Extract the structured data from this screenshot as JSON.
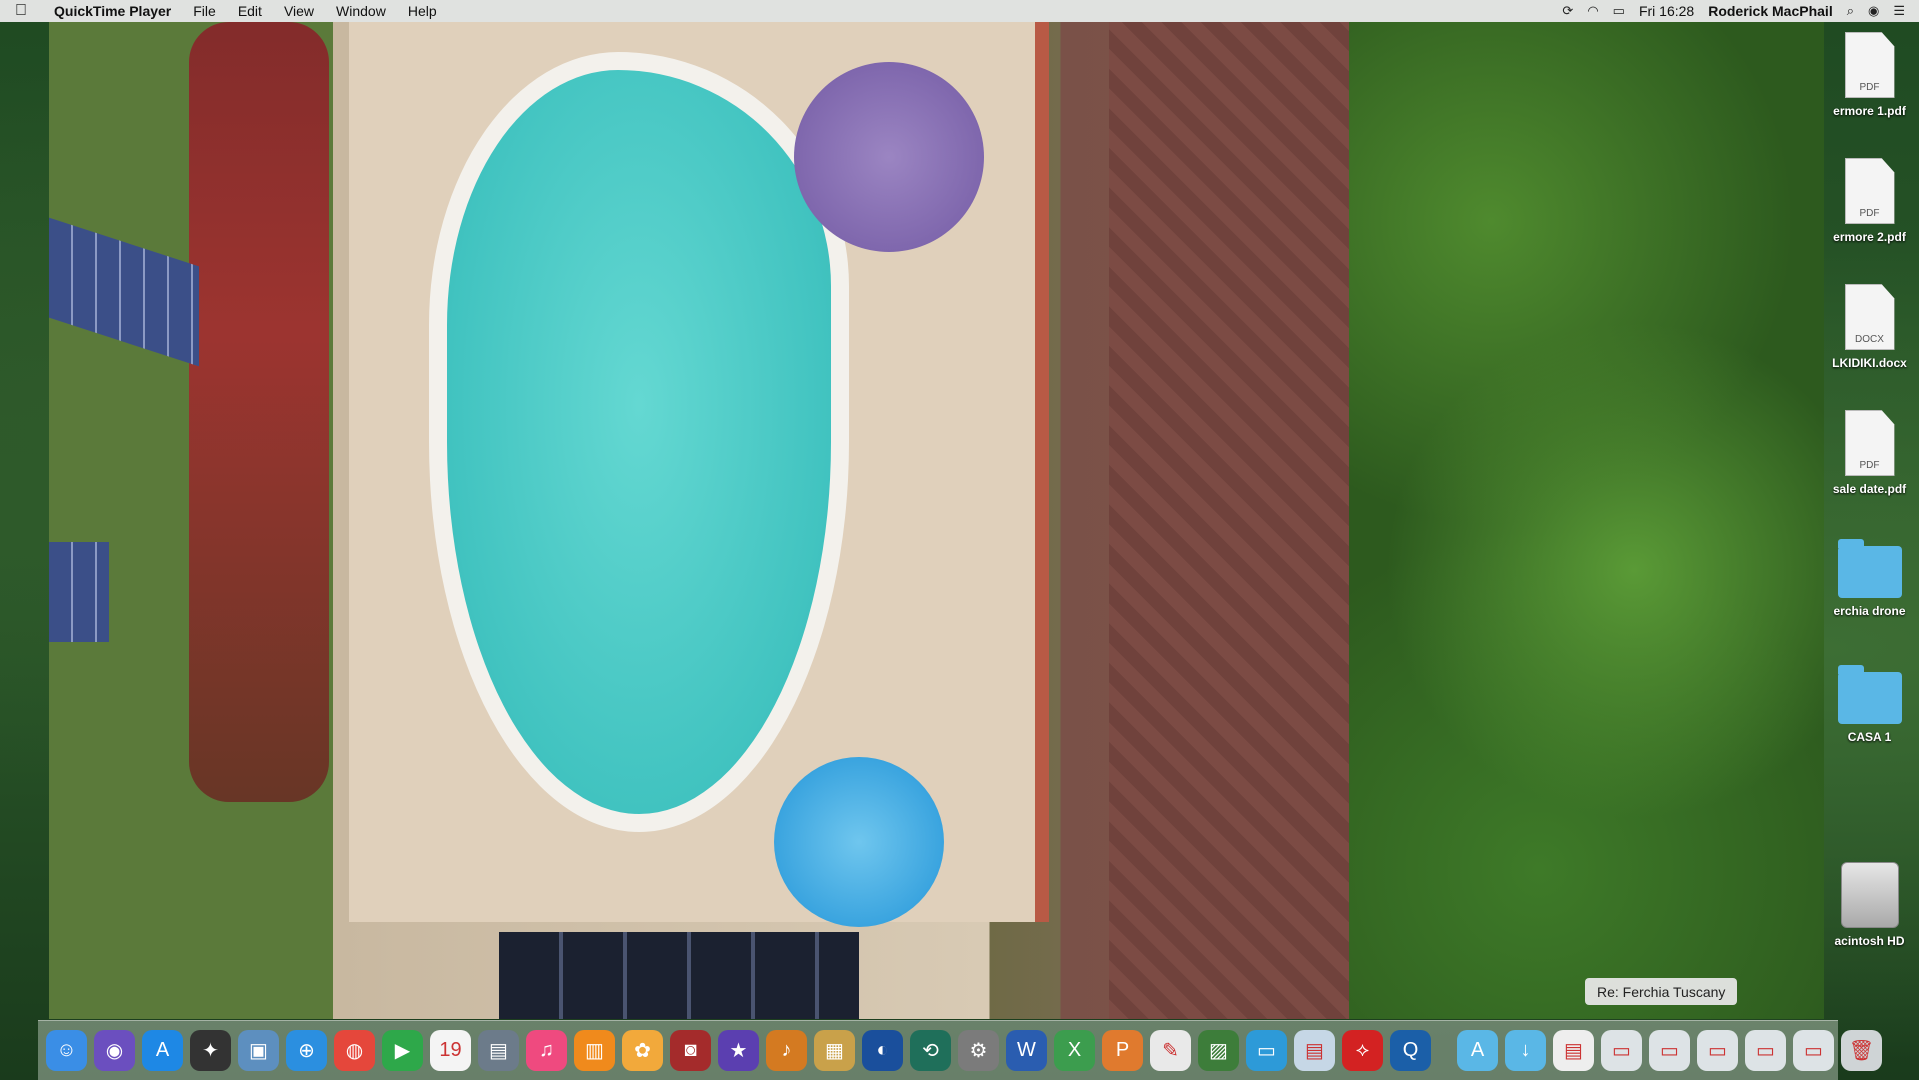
{
  "menubar": {
    "app_name": "QuickTime Player",
    "menus": [
      "File",
      "Edit",
      "View",
      "Window",
      "Help"
    ],
    "clock": "Fri 16:28",
    "user": "Roderick MacPhail"
  },
  "desktop": {
    "items": [
      {
        "label": "ermore 1.pdf",
        "kind": "doc",
        "type": "PDF"
      },
      {
        "label": "ermore 2.pdf",
        "kind": "doc",
        "type": "PDF"
      },
      {
        "label": "LKIDIKI.docx",
        "kind": "doc",
        "type": "DOCX"
      },
      {
        "label": "sale date.pdf",
        "kind": "doc",
        "type": "PDF"
      },
      {
        "label": "erchia drone",
        "kind": "folder"
      },
      {
        "label": "CASA 1",
        "kind": "folder"
      },
      {
        "label": "acintosh HD",
        "kind": "drive"
      }
    ]
  },
  "tooltip": {
    "text": "Re: Ferchia Tuscany"
  },
  "dock": {
    "apps": [
      {
        "icon": "finder-icon",
        "glyph": "☺",
        "color": "#3a8ee6"
      },
      {
        "icon": "siri-icon",
        "glyph": "◉",
        "color": "#6b4fbf"
      },
      {
        "icon": "app-store-icon",
        "glyph": "A",
        "color": "#1e88e5"
      },
      {
        "icon": "launchpad-icon",
        "glyph": "✦",
        "color": "#333333"
      },
      {
        "icon": "preview-icon",
        "glyph": "▣",
        "color": "#5d8fbf"
      },
      {
        "icon": "safari-icon",
        "glyph": "⊕",
        "color": "#2b8fe0"
      },
      {
        "icon": "chrome-icon",
        "glyph": "◍",
        "color": "#e5473b"
      },
      {
        "icon": "facetime-icon",
        "glyph": "▶",
        "color": "#2ea84a"
      },
      {
        "icon": "calendar-icon",
        "glyph": "19",
        "color": "#f4f4f4"
      },
      {
        "icon": "image-capture-icon",
        "glyph": "▤",
        "color": "#6c7b8a"
      },
      {
        "icon": "itunes-icon",
        "glyph": "♫",
        "color": "#ef4a7f"
      },
      {
        "icon": "ibooks-icon",
        "glyph": "▥",
        "color": "#f08a1c"
      },
      {
        "icon": "photos-icon",
        "glyph": "✿",
        "color": "#f2a93b"
      },
      {
        "icon": "photo-booth-icon",
        "glyph": "◙",
        "color": "#a42b2b"
      },
      {
        "icon": "imovie-icon",
        "glyph": "★",
        "color": "#5b3fb0"
      },
      {
        "icon": "garageband-icon",
        "glyph": "♪",
        "color": "#d47a21"
      },
      {
        "icon": "notes-icon",
        "glyph": "▦",
        "color": "#c9a14a"
      },
      {
        "icon": "google-earth-icon",
        "glyph": "◐",
        "color": "#1a4f9c"
      },
      {
        "icon": "time-machine-icon",
        "glyph": "⟲",
        "color": "#1f6f5a"
      },
      {
        "icon": "system-preferences-icon",
        "glyph": "⚙",
        "color": "#7b7b7b"
      },
      {
        "icon": "word-icon",
        "glyph": "W",
        "color": "#2a5db0"
      },
      {
        "icon": "excel-icon",
        "glyph": "X",
        "color": "#3c9d4e"
      },
      {
        "icon": "powerpoint-icon",
        "glyph": "P",
        "color": "#e07a2e"
      },
      {
        "icon": "textedit-icon",
        "glyph": "✎",
        "color": "#e9e9e9"
      },
      {
        "icon": "photo-app-icon",
        "glyph": "▨",
        "color": "#3d7d3a"
      },
      {
        "icon": "screen-sharing-icon",
        "glyph": "▭",
        "color": "#2d9ad8"
      },
      {
        "icon": "preview-images-icon",
        "glyph": "▤",
        "color": "#c6d7e6"
      },
      {
        "icon": "acrobat-icon",
        "glyph": "⟡",
        "color": "#d32222"
      },
      {
        "icon": "quicktime-icon",
        "glyph": "Q",
        "color": "#1b5fa8"
      }
    ],
    "stacks": [
      {
        "icon": "applications-folder-icon",
        "glyph": "A",
        "color": "#5ab7e6"
      },
      {
        "icon": "downloads-folder-icon",
        "glyph": "↓",
        "color": "#5ab7e6"
      },
      {
        "icon": "document-stack-icon",
        "glyph": "▤",
        "color": "#eeeeee"
      },
      {
        "icon": "window-minimized-1-icon",
        "glyph": "▭",
        "color": "#dde3e6"
      },
      {
        "icon": "window-minimized-2-icon",
        "glyph": "▭",
        "color": "#dde3e6"
      },
      {
        "icon": "window-minimized-3-icon",
        "glyph": "▭",
        "color": "#dde3e6"
      },
      {
        "icon": "window-minimized-4-icon",
        "glyph": "▭",
        "color": "#dde3e6"
      },
      {
        "icon": "window-minimized-5-icon",
        "glyph": "▭",
        "color": "#dde3e6"
      },
      {
        "icon": "trash-icon",
        "glyph": "🗑",
        "color": "#cfd4d6"
      }
    ]
  }
}
